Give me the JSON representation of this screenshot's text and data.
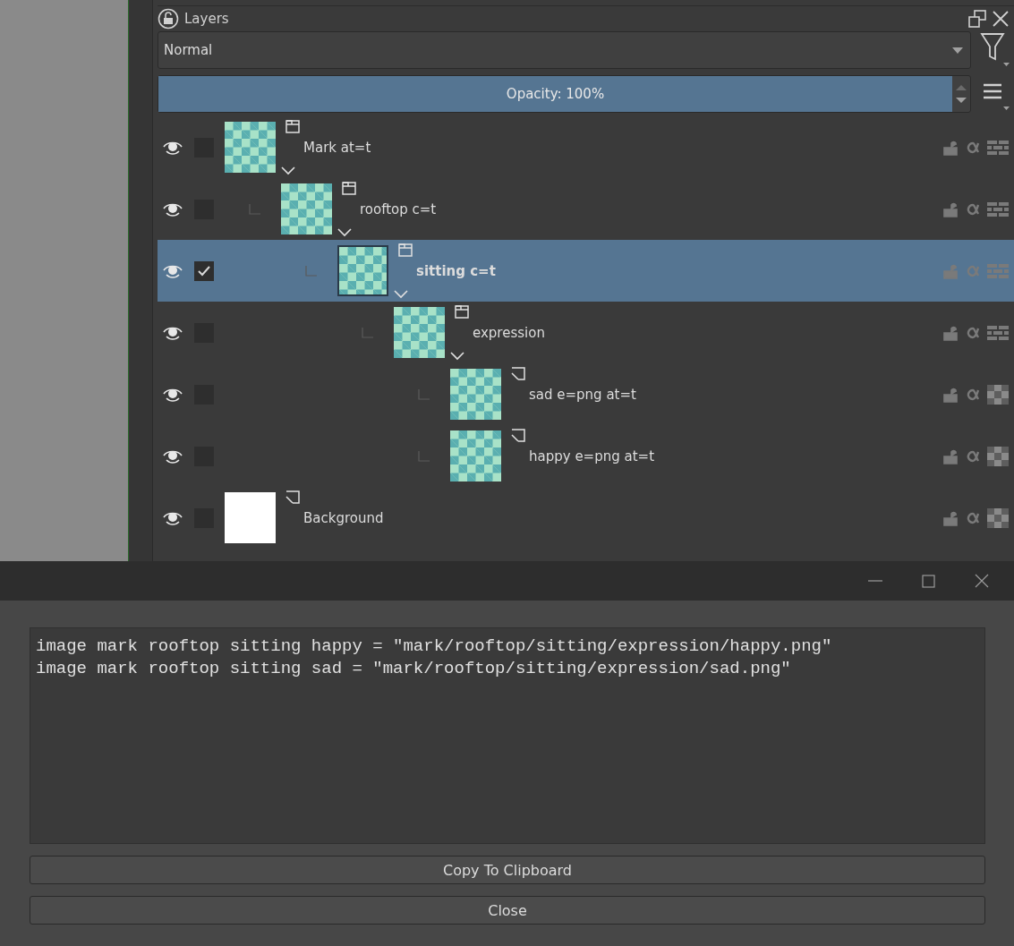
{
  "layers_docker": {
    "title": "Layers",
    "blend_mode": "Normal",
    "opacity_label": "Opacity:  100%",
    "opacity": {
      "level": 1
    },
    "layers": [
      {
        "name": "Mark at=t",
        "kind": "group",
        "visible": true,
        "checked": false,
        "selected": false,
        "expanded": true,
        "blank_thumbnail": false,
        "children": [
          {
            "name": "rooftop c=t",
            "kind": "group",
            "visible": true,
            "checked": false,
            "selected": false,
            "expanded": true,
            "blank_thumbnail": false,
            "children": [
              {
                "name": "sitting c=t",
                "kind": "group",
                "visible": true,
                "checked": true,
                "selected": true,
                "expanded": true,
                "blank_thumbnail": false,
                "children": [
                  {
                    "name": "expression",
                    "kind": "group",
                    "visible": true,
                    "checked": false,
                    "selected": false,
                    "expanded": true,
                    "blank_thumbnail": false,
                    "children": [
                      {
                        "name": "sad e=png at=t",
                        "kind": "paint",
                        "visible": true,
                        "checked": false,
                        "selected": false,
                        "blank_thumbnail": false
                      },
                      {
                        "name": "happy e=png at=t",
                        "kind": "paint",
                        "visible": true,
                        "checked": false,
                        "selected": false,
                        "blank_thumbnail": false
                      }
                    ]
                  }
                ]
              }
            ]
          }
        ]
      },
      {
        "name": "Background",
        "kind": "paint",
        "visible": true,
        "checked": false,
        "selected": false,
        "blank_thumbnail": true
      }
    ]
  },
  "dialog": {
    "output_lines": [
      "image mark rooftop sitting happy = \"mark/rooftop/sitting/expression/happy.png\"",
      "image mark rooftop sitting sad = \"mark/rooftop/sitting/expression/sad.png\""
    ],
    "buttons": [
      "Copy To Clipboard",
      "Close"
    ]
  }
}
